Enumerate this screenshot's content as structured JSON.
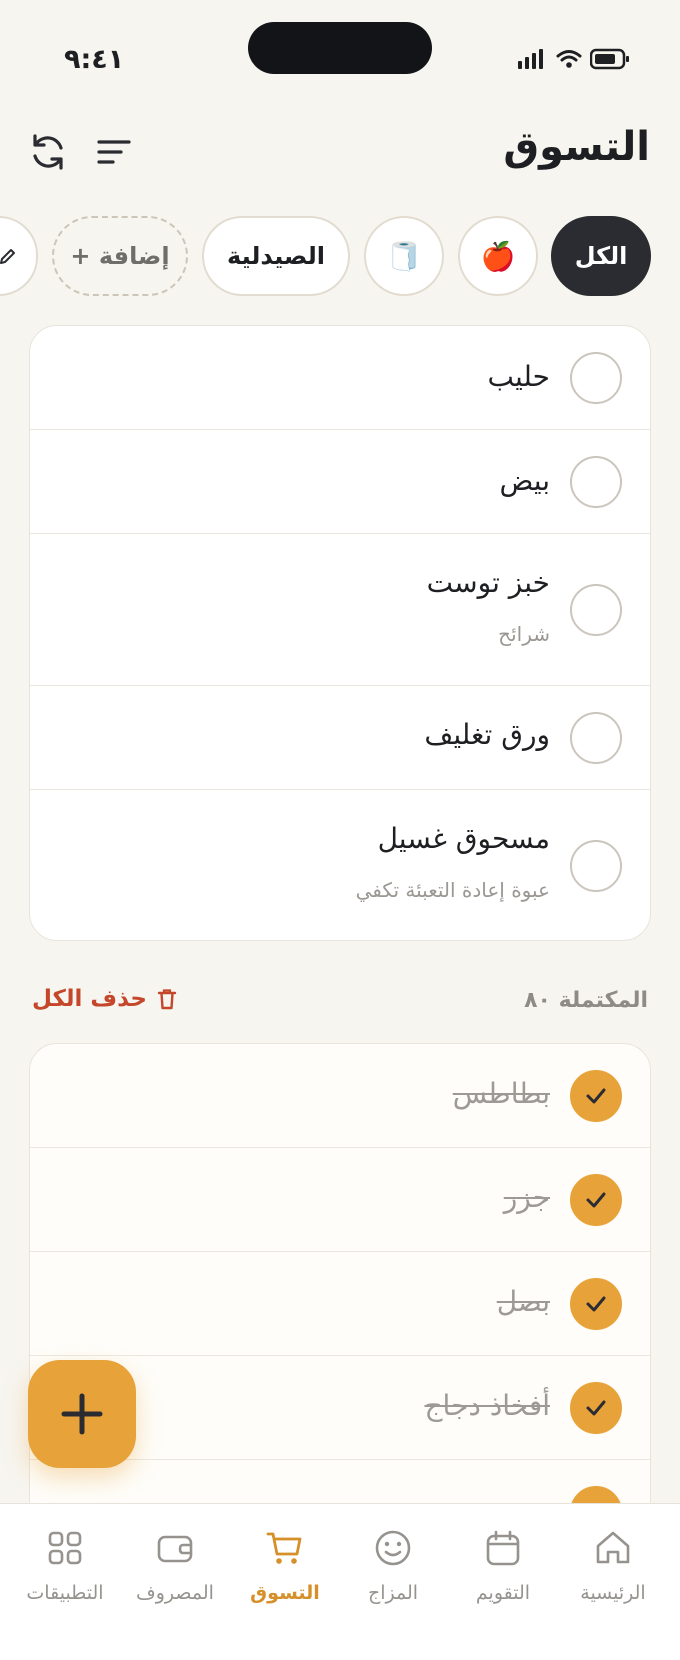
{
  "status_bar": {
    "time": "٩:٤١"
  },
  "header": {
    "title": "التسوق",
    "refresh_icon": "refresh-icon",
    "sort_icon": "sort-icon"
  },
  "filters": {
    "chips": [
      {
        "label": "الكل",
        "active": true
      },
      {
        "icon": "🍎",
        "icon_name": "apple-icon"
      },
      {
        "icon": "🧻",
        "icon_name": "paper-towel-icon"
      },
      {
        "label": "الصيدلية"
      },
      {
        "label": "+ إضافة"
      }
    ],
    "edit_icon": "pencil-icon"
  },
  "active_items": [
    {
      "name": "حليب",
      "note": ""
    },
    {
      "name": "بيض",
      "note": ""
    },
    {
      "name": "خبز توست",
      "note": "شرائح"
    },
    {
      "name": "ورق تغليف",
      "note": ""
    },
    {
      "name": "مسحوق غسيل",
      "note": "عبوة إعادة التعبئة تكفي"
    }
  ],
  "completed": {
    "label": "المكتملة ٨٠",
    "clear_label": "حذف الكل",
    "items": [
      {
        "name": "بطاطس"
      },
      {
        "name": "جزر"
      },
      {
        "name": "بصل"
      },
      {
        "name": "أفخاذ دجاج"
      }
    ]
  },
  "tab_bar": {
    "tabs": [
      {
        "label": "الرئيسية",
        "icon": "home-icon"
      },
      {
        "label": "التقويم",
        "icon": "calendar-icon"
      },
      {
        "label": "المزاج",
        "icon": "smile-icon"
      },
      {
        "label": "التسوق",
        "icon": "cart-icon",
        "active": true
      },
      {
        "label": "المصروف",
        "icon": "wallet-icon"
      },
      {
        "label": "التطبيقات",
        "icon": "apps-grid-icon"
      }
    ]
  },
  "colors": {
    "accent": "#e8a23a",
    "dark": "#2a2c31",
    "danger": "#c4472b",
    "background": "#f7f5f0"
  }
}
